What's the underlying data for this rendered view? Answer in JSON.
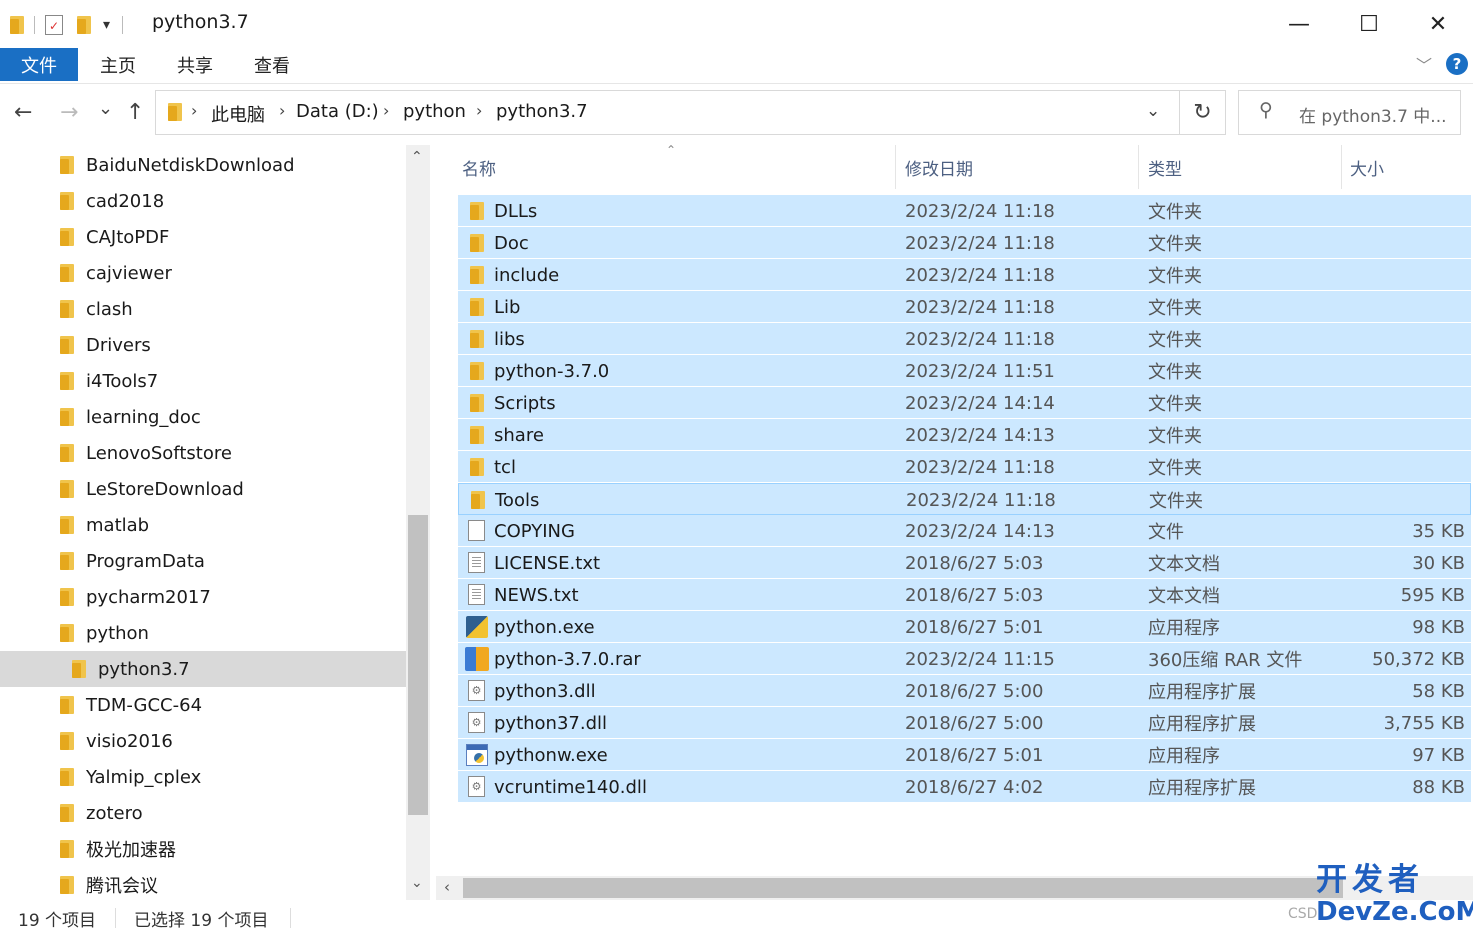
{
  "window": {
    "title": "python3.7",
    "qa_dropdown": "▾",
    "min_glyph": "—",
    "max_glyph": "☐",
    "close_glyph": "✕",
    "icons": [
      "folder-icon",
      "properties-icon",
      "new-folder-icon"
    ]
  },
  "ribbon": {
    "tabs": [
      "文件",
      "主页",
      "共享",
      "查看"
    ],
    "expand_glyph": "﹀",
    "help_glyph": "?"
  },
  "nav": {
    "back_glyph": "←",
    "forward_glyph": "→",
    "recent_glyph": "⌄",
    "up_glyph": "↑",
    "refresh_glyph": "↻",
    "dropdown_glyph": "⌄"
  },
  "breadcrumb": {
    "separator": "›",
    "items": [
      "此电脑",
      "Data (D:)",
      "python",
      "python3.7"
    ]
  },
  "search": {
    "placeholder": "在 python3.7 中...",
    "icon": "search-icon",
    "glyph": "⚲"
  },
  "navpane": {
    "items": [
      {
        "label": "BaiduNetdiskDownload"
      },
      {
        "label": "cad2018"
      },
      {
        "label": "CAJtoPDF"
      },
      {
        "label": "cajviewer"
      },
      {
        "label": "clash"
      },
      {
        "label": "Drivers"
      },
      {
        "label": "i4Tools7"
      },
      {
        "label": "learning_doc"
      },
      {
        "label": "LenovoSoftstore"
      },
      {
        "label": "LeStoreDownload"
      },
      {
        "label": "matlab"
      },
      {
        "label": "ProgramData"
      },
      {
        "label": "pycharm2017"
      },
      {
        "label": "python"
      },
      {
        "label": "python3.7",
        "selected": true
      },
      {
        "label": "TDM-GCC-64"
      },
      {
        "label": "visio2016"
      },
      {
        "label": "Yalmip_cplex"
      },
      {
        "label": "zotero"
      },
      {
        "label": "极光加速器"
      },
      {
        "label": "腾讯会议"
      }
    ],
    "scroll_up_glyph": "⌃",
    "scroll_down_glyph": "⌄"
  },
  "columns": {
    "name": "名称",
    "date": "修改日期",
    "type": "类型",
    "size": "大小",
    "sort_glyph": "⌃"
  },
  "files": [
    {
      "name": "DLLs",
      "date": "2023/2/24 11:18",
      "type": "文件夹",
      "size": "",
      "icon": "folder"
    },
    {
      "name": "Doc",
      "date": "2023/2/24 11:18",
      "type": "文件夹",
      "size": "",
      "icon": "folder"
    },
    {
      "name": "include",
      "date": "2023/2/24 11:18",
      "type": "文件夹",
      "size": "",
      "icon": "folder"
    },
    {
      "name": "Lib",
      "date": "2023/2/24 11:18",
      "type": "文件夹",
      "size": "",
      "icon": "folder"
    },
    {
      "name": "libs",
      "date": "2023/2/24 11:18",
      "type": "文件夹",
      "size": "",
      "icon": "folder"
    },
    {
      "name": "python-3.7.0",
      "date": "2023/2/24 11:51",
      "type": "文件夹",
      "size": "",
      "icon": "folder"
    },
    {
      "name": "Scripts",
      "date": "2023/2/24 14:14",
      "type": "文件夹",
      "size": "",
      "icon": "folder"
    },
    {
      "name": "share",
      "date": "2023/2/24 14:13",
      "type": "文件夹",
      "size": "",
      "icon": "folder"
    },
    {
      "name": "tcl",
      "date": "2023/2/24 11:18",
      "type": "文件夹",
      "size": "",
      "icon": "folder"
    },
    {
      "name": "Tools",
      "date": "2023/2/24 11:18",
      "type": "文件夹",
      "size": "",
      "icon": "folder",
      "focused": true
    },
    {
      "name": "COPYING",
      "date": "2023/2/24 14:13",
      "type": "文件",
      "size": "35 KB",
      "icon": "file"
    },
    {
      "name": "LICENSE.txt",
      "date": "2018/6/27 5:03",
      "type": "文本文档",
      "size": "30 KB",
      "icon": "text"
    },
    {
      "name": "NEWS.txt",
      "date": "2018/6/27 5:03",
      "type": "文本文档",
      "size": "595 KB",
      "icon": "text"
    },
    {
      "name": "python.exe",
      "date": "2018/6/27 5:01",
      "type": "应用程序",
      "size": "98 KB",
      "icon": "python-exe"
    },
    {
      "name": "python-3.7.0.rar",
      "date": "2023/2/24 11:15",
      "type": "360压缩 RAR 文件",
      "size": "50,372 KB",
      "icon": "rar"
    },
    {
      "name": "python3.dll",
      "date": "2018/6/27 5:00",
      "type": "应用程序扩展",
      "size": "58 KB",
      "icon": "dll"
    },
    {
      "name": "python37.dll",
      "date": "2018/6/27 5:00",
      "type": "应用程序扩展",
      "size": "3,755 KB",
      "icon": "dll"
    },
    {
      "name": "pythonw.exe",
      "date": "2018/6/27 5:01",
      "type": "应用程序",
      "size": "97 KB",
      "icon": "pythonw-exe"
    },
    {
      "name": "vcruntime140.dll",
      "date": "2018/6/27 4:02",
      "type": "应用程序扩展",
      "size": "88 KB",
      "icon": "dll"
    }
  ],
  "hscroll_left_glyph": "‹",
  "status": {
    "count": "19 个项目",
    "selected": "已选择 19 个项目"
  },
  "watermark": {
    "line1": "开发者",
    "line2": "DevZe.CoM",
    "prefix": "CSD"
  },
  "colors": {
    "accent": "#1a6fc4",
    "selection": "#cce8ff",
    "selection_border": "#99d1ff",
    "nav_selected": "#d9d9d9"
  }
}
